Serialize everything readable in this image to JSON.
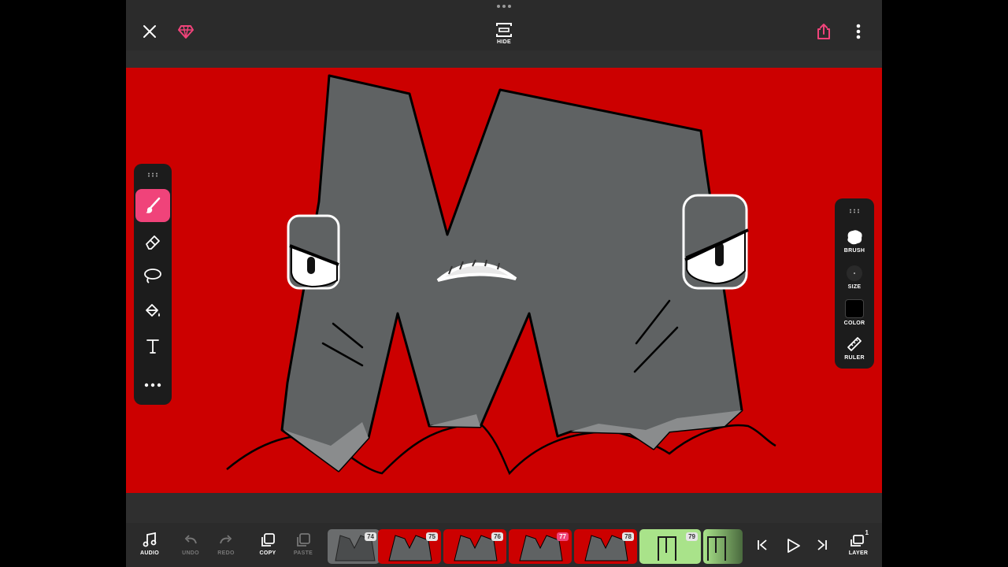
{
  "top": {
    "hide_label": "HIDE"
  },
  "left_tools": [
    "brush",
    "eraser",
    "lasso",
    "fill",
    "text",
    "more"
  ],
  "right_tools": {
    "brush": "BRUSH",
    "size": "SIZE",
    "color": "COLOR",
    "ruler": "RULER"
  },
  "bottom": {
    "audio": "AUDIO",
    "undo": "UNDO",
    "redo": "REDO",
    "copy": "COPY",
    "paste": "PASTE",
    "layer": "LAYER",
    "layer_count": "1"
  },
  "frames": [
    {
      "number": "74",
      "style": "gray"
    },
    {
      "number": "75",
      "style": "red"
    },
    {
      "number": "76",
      "style": "red"
    },
    {
      "number": "77",
      "style": "red",
      "current": true
    },
    {
      "number": "78",
      "style": "red"
    },
    {
      "number": "79",
      "style": "green"
    },
    {
      "number": "",
      "style": "green"
    }
  ],
  "colors": {
    "accent": "#f0437a",
    "canvas_bg": "#cc0000",
    "letter": "#5f6263",
    "current_color": "#000000"
  }
}
